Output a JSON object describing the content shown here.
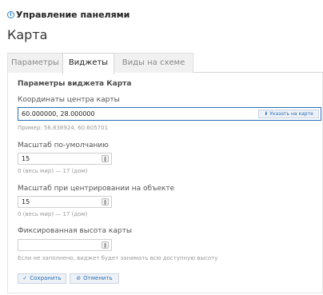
{
  "header": {
    "title": "Управление панелями",
    "info_icon": "info-icon"
  },
  "page": {
    "title": "Карта"
  },
  "tabs": [
    {
      "label": "Параметры",
      "active": false
    },
    {
      "label": "Виджеты",
      "active": true
    },
    {
      "label": "Виды на схеме",
      "active": false
    }
  ],
  "form": {
    "section_title": "Параметры виджета Карта",
    "center": {
      "label": "Координаты центра карты",
      "value": "60.000000, 28.000000",
      "button_label": "Указать на карте",
      "button_icon": "map-pin-icon",
      "hint": "Пример: 56.838924, 60.605701"
    },
    "default_zoom": {
      "label": "Масштаб по-умолчанию",
      "value": "15",
      "hint": "0 (весь мир) — 17 (дом)"
    },
    "object_zoom": {
      "label": "Масштаб при центрировании на объекте",
      "value": "15",
      "hint": "0 (весь мир) — 17 (дом)"
    },
    "fixed_height": {
      "label": "Фиксированная высота карты",
      "value": "",
      "hint": "Если не заполнено, виджет будет занимать всю доступную высоту"
    },
    "save_label": "Сохранить",
    "cancel_label": "Отменить"
  },
  "colors": {
    "accent": "#2a6db5",
    "input_border_active": "#2a70b8",
    "tab_bg": "#f1f1f1"
  }
}
